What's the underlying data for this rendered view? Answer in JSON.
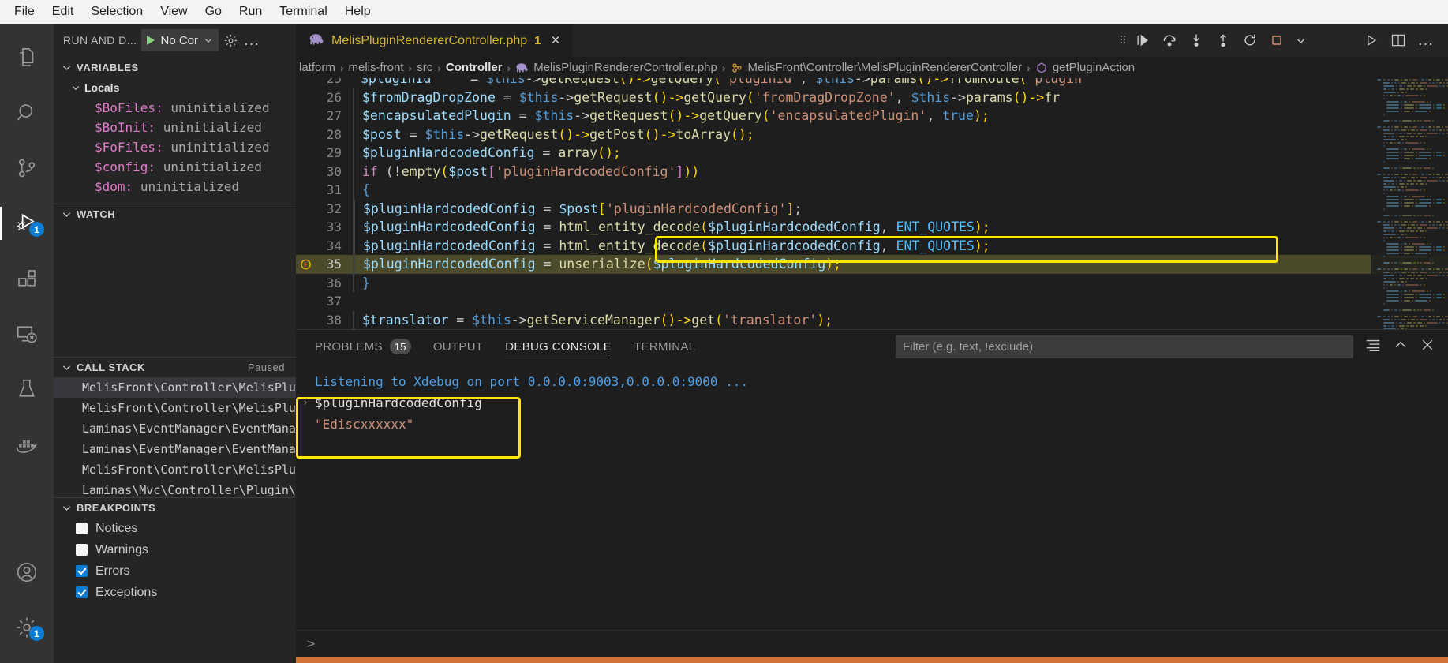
{
  "menubar": {
    "items": [
      "File",
      "Edit",
      "Selection",
      "View",
      "Go",
      "Run",
      "Terminal",
      "Help"
    ]
  },
  "activitybar": {
    "items": [
      {
        "name": "explorer-icon",
        "label": "Explorer",
        "active": false
      },
      {
        "name": "search-icon",
        "label": "Search",
        "active": false
      },
      {
        "name": "source-control-icon",
        "label": "Source Control",
        "active": false
      },
      {
        "name": "run-and-debug-icon",
        "label": "Run and Debug",
        "active": true,
        "badge": "1"
      },
      {
        "name": "extensions-icon",
        "label": "Extensions",
        "active": false
      },
      {
        "name": "remote-explorer-icon",
        "label": "Remote Explorer",
        "active": false
      },
      {
        "name": "testing-icon",
        "label": "Testing",
        "active": false
      },
      {
        "name": "docker-icon",
        "label": "Docker",
        "active": false
      }
    ],
    "bottom": [
      {
        "name": "accounts-icon",
        "label": "Accounts"
      },
      {
        "name": "settings-gear-icon",
        "label": "Manage",
        "badge": "1"
      }
    ]
  },
  "sidebar": {
    "title": "RUN AND D...",
    "config_label": "No Cor",
    "gear_title": "Open launch.json",
    "more_title": "Views and More Actions...",
    "variables": {
      "title": "VARIABLES",
      "scope": "Locals",
      "rows": [
        {
          "name": "$BoFiles:",
          "value": "uninitialized"
        },
        {
          "name": "$BoInit:",
          "value": "uninitialized"
        },
        {
          "name": "$FoFiles:",
          "value": "uninitialized"
        },
        {
          "name": "$config:",
          "value": "uninitialized"
        },
        {
          "name": "$dom:",
          "value": "uninitialized"
        }
      ]
    },
    "watch": {
      "title": "WATCH",
      "rows": []
    },
    "callstack": {
      "title": "CALL STACK",
      "status": "Paused",
      "rows": [
        "MelisFront\\Controller\\MelisPluginRe",
        "MelisFront\\Controller\\MelisPluginRe",
        "Laminas\\EventManager\\EventManager->",
        "Laminas\\EventManager\\EventManager->",
        "MelisFront\\Controller\\MelisPluginRe",
        "Laminas\\Mvc\\Controller\\Plugin\\Forw"
      ],
      "selected_index": 0
    },
    "breakpoints": {
      "title": "BREAKPOINTS",
      "rows": [
        {
          "label": "Notices",
          "checked": false
        },
        {
          "label": "Warnings",
          "checked": false
        },
        {
          "label": "Errors",
          "checked": true
        },
        {
          "label": "Exceptions",
          "checked": true
        }
      ]
    }
  },
  "editor": {
    "tab": {
      "filename": "MelisPluginRendererController.php",
      "problem_count": "1",
      "icon": "php-elephant-icon",
      "close_label": "×"
    },
    "tab_actions": [
      {
        "name": "run-python-icon",
        "label": "Run or Debug..."
      },
      {
        "name": "split-editor-icon",
        "label": "Split Editor Right"
      },
      {
        "name": "more-actions-icon",
        "label": "More Actions..."
      }
    ],
    "debug_toolbar": [
      {
        "name": "drag-grip-icon",
        "label": "Drag"
      },
      {
        "name": "continue-icon",
        "label": "Continue"
      },
      {
        "name": "step-over-icon",
        "label": "Step Over"
      },
      {
        "name": "step-into-icon",
        "label": "Step Into"
      },
      {
        "name": "step-out-icon",
        "label": "Step Out"
      },
      {
        "name": "restart-icon",
        "label": "Restart"
      },
      {
        "name": "stop-icon",
        "label": "Stop"
      },
      {
        "name": "chevron-down-icon",
        "label": "More"
      }
    ],
    "breadcrumbs": [
      {
        "text": "latform",
        "bold": false,
        "icon": null
      },
      {
        "text": "melis-front",
        "bold": false,
        "icon": null
      },
      {
        "text": "src",
        "bold": false,
        "icon": null
      },
      {
        "text": "Controller",
        "bold": true,
        "icon": null
      },
      {
        "text": "MelisPluginRendererController.php",
        "bold": false,
        "icon": "php-elephant-icon"
      },
      {
        "text": "MelisFront\\Controller\\MelisPluginRendererController",
        "bold": false,
        "icon": "class-icon"
      },
      {
        "text": "getPluginAction",
        "bold": false,
        "icon": "method-icon"
      }
    ],
    "lines": [
      {
        "num": "25",
        "clipped": true,
        "indent": 0,
        "tokens": [
          {
            "t": "$pluginId",
            "c": "t-var"
          },
          {
            "t": "     = ",
            "c": "t-punc"
          },
          {
            "t": "$this",
            "c": "t-ctl"
          },
          {
            "t": "->",
            "c": "t-punc"
          },
          {
            "t": "getRequest",
            "c": "t-fn"
          },
          {
            "t": "()->",
            "c": "t-brk"
          },
          {
            "t": "getQuery",
            "c": "t-fn"
          },
          {
            "t": "(",
            "c": "t-brk"
          },
          {
            "t": "'pluginId'",
            "c": "t-str"
          },
          {
            "t": ", ",
            "c": "t-punc"
          },
          {
            "t": "$this",
            "c": "t-ctl"
          },
          {
            "t": "->",
            "c": "t-punc"
          },
          {
            "t": "params",
            "c": "t-fn"
          },
          {
            "t": "()->",
            "c": "t-brk"
          },
          {
            "t": "fromRoute",
            "c": "t-fn"
          },
          {
            "t": "(",
            "c": "t-brk"
          },
          {
            "t": "'plugin",
            "c": "t-str"
          }
        ]
      },
      {
        "num": "26",
        "indent": 2,
        "tokens": [
          {
            "t": "$fromDragDropZone",
            "c": "t-var"
          },
          {
            "t": " = ",
            "c": "t-punc"
          },
          {
            "t": "$this",
            "c": "t-ctl"
          },
          {
            "t": "->",
            "c": "t-punc"
          },
          {
            "t": "getRequest",
            "c": "t-fn"
          },
          {
            "t": "()->",
            "c": "t-brk"
          },
          {
            "t": "getQuery",
            "c": "t-fn"
          },
          {
            "t": "(",
            "c": "t-brk"
          },
          {
            "t": "'fromDragDropZone'",
            "c": "t-str"
          },
          {
            "t": ", ",
            "c": "t-punc"
          },
          {
            "t": "$this",
            "c": "t-ctl"
          },
          {
            "t": "->",
            "c": "t-punc"
          },
          {
            "t": "params",
            "c": "t-fn"
          },
          {
            "t": "()->",
            "c": "t-brk"
          },
          {
            "t": "fr",
            "c": "t-fn"
          }
        ]
      },
      {
        "num": "27",
        "indent": 2,
        "tokens": [
          {
            "t": "$encapsulatedPlugin",
            "c": "t-var"
          },
          {
            "t": " = ",
            "c": "t-punc"
          },
          {
            "t": "$this",
            "c": "t-ctl"
          },
          {
            "t": "->",
            "c": "t-punc"
          },
          {
            "t": "getRequest",
            "c": "t-fn"
          },
          {
            "t": "()->",
            "c": "t-brk"
          },
          {
            "t": "getQuery",
            "c": "t-fn"
          },
          {
            "t": "(",
            "c": "t-brk"
          },
          {
            "t": "'encapsulatedPlugin'",
            "c": "t-str"
          },
          {
            "t": ", ",
            "c": "t-punc"
          },
          {
            "t": "true",
            "c": "t-ctl"
          },
          {
            "t": ");",
            "c": "t-brk"
          }
        ]
      },
      {
        "num": "28",
        "indent": 2,
        "tokens": [
          {
            "t": "$post",
            "c": "t-var"
          },
          {
            "t": " = ",
            "c": "t-punc"
          },
          {
            "t": "$this",
            "c": "t-ctl"
          },
          {
            "t": "->",
            "c": "t-punc"
          },
          {
            "t": "getRequest",
            "c": "t-fn"
          },
          {
            "t": "()->",
            "c": "t-brk"
          },
          {
            "t": "getPost",
            "c": "t-fn"
          },
          {
            "t": "()->",
            "c": "t-brk"
          },
          {
            "t": "toArray",
            "c": "t-fn"
          },
          {
            "t": "();",
            "c": "t-brk"
          }
        ]
      },
      {
        "num": "29",
        "indent": 2,
        "tokens": [
          {
            "t": "$pluginHardcodedConfig",
            "c": "t-var"
          },
          {
            "t": " = ",
            "c": "t-punc"
          },
          {
            "t": "array",
            "c": "t-fn"
          },
          {
            "t": "();",
            "c": "t-brk"
          }
        ]
      },
      {
        "num": "30",
        "indent": 2,
        "tokens": [
          {
            "t": "if",
            "c": "t-kw"
          },
          {
            "t": " (!",
            "c": "t-punc"
          },
          {
            "t": "empty",
            "c": "t-fn"
          },
          {
            "t": "(",
            "c": "t-brk"
          },
          {
            "t": "$post",
            "c": "t-var"
          },
          {
            "t": "[",
            "c": "t-brk2"
          },
          {
            "t": "'pluginHardcodedConfig'",
            "c": "t-str"
          },
          {
            "t": "]",
            "c": "t-brk2"
          },
          {
            "t": "))",
            "c": "t-brk"
          }
        ]
      },
      {
        "num": "31",
        "indent": 2,
        "tokens": [
          {
            "t": "{",
            "c": "t-brace"
          }
        ]
      },
      {
        "num": "32",
        "indent": 3,
        "tokens": [
          {
            "t": "$pluginHardcodedConfig",
            "c": "t-var"
          },
          {
            "t": " = ",
            "c": "t-punc"
          },
          {
            "t": "$post",
            "c": "t-var"
          },
          {
            "t": "[",
            "c": "t-brk"
          },
          {
            "t": "'pluginHardcodedConfig'",
            "c": "t-str"
          },
          {
            "t": "]",
            "c": "t-brk"
          },
          {
            "t": ";",
            "c": "t-punc"
          }
        ]
      },
      {
        "num": "33",
        "indent": 3,
        "tokens": [
          {
            "t": "$pluginHardcodedConfig",
            "c": "t-var"
          },
          {
            "t": " = ",
            "c": "t-punc"
          },
          {
            "t": "html_entity_decode",
            "c": "t-fn"
          },
          {
            "t": "(",
            "c": "t-brk"
          },
          {
            "t": "$pluginHardcodedConfig",
            "c": "t-var"
          },
          {
            "t": ", ",
            "c": "t-punc"
          },
          {
            "t": "ENT_QUOTES",
            "c": "t-const"
          },
          {
            "t": ");",
            "c": "t-brk"
          }
        ]
      },
      {
        "num": "34",
        "indent": 3,
        "tokens": [
          {
            "t": "$pluginHardcodedConfig",
            "c": "t-var"
          },
          {
            "t": " = ",
            "c": "t-punc"
          },
          {
            "t": "html_entity_decode",
            "c": "t-fn"
          },
          {
            "t": "(",
            "c": "t-brk"
          },
          {
            "t": "$pluginHardcodedConfig",
            "c": "t-var"
          },
          {
            "t": ", ",
            "c": "t-punc"
          },
          {
            "t": "ENT_QUOTES",
            "c": "t-const"
          },
          {
            "t": ");",
            "c": "t-brk"
          }
        ]
      },
      {
        "num": "35",
        "indent": 3,
        "highlighted": true,
        "breakpoint": true,
        "tokens": [
          {
            "t": "$pluginHardcodedConfig",
            "c": "t-var"
          },
          {
            "t": " = ",
            "c": "t-punc"
          },
          {
            "t": "unserialize",
            "c": "t-fn"
          },
          {
            "t": "(",
            "c": "t-brk"
          },
          {
            "t": "$pluginHardcodedConfig",
            "c": "t-var"
          },
          {
            "t": ");",
            "c": "t-brk"
          }
        ]
      },
      {
        "num": "36",
        "indent": 2,
        "tokens": [
          {
            "t": "}",
            "c": "t-brace"
          }
        ]
      },
      {
        "num": "37",
        "indent": 0,
        "tokens": []
      },
      {
        "num": "38",
        "indent": 2,
        "tokens": [
          {
            "t": "$translator",
            "c": "t-var"
          },
          {
            "t": " = ",
            "c": "t-punc"
          },
          {
            "t": "$this",
            "c": "t-ctl"
          },
          {
            "t": "->",
            "c": "t-punc"
          },
          {
            "t": "getServiceManager",
            "c": "t-fn"
          },
          {
            "t": "()->",
            "c": "t-brk"
          },
          {
            "t": "get",
            "c": "t-fn"
          },
          {
            "t": "(",
            "c": "t-brk"
          },
          {
            "t": "'translator'",
            "c": "t-str"
          },
          {
            "t": ");",
            "c": "t-brk"
          }
        ]
      },
      {
        "num": "39",
        "clipped": true,
        "indent": 0,
        "tokens": []
      }
    ],
    "annotation_code": "highlight-box-line-35"
  },
  "panel": {
    "tabs": [
      {
        "label": "PROBLEMS",
        "badge": "15",
        "active": false
      },
      {
        "label": "OUTPUT",
        "badge": null,
        "active": false
      },
      {
        "label": "DEBUG CONSOLE",
        "badge": null,
        "active": true
      },
      {
        "label": "TERMINAL",
        "badge": null,
        "active": false
      }
    ],
    "filter_placeholder": "Filter (e.g. text, !exclude)",
    "filter_value": "",
    "actions": [
      {
        "name": "clear-console-icon",
        "label": "Clear Console"
      },
      {
        "name": "chevron-up-icon",
        "label": "Maximize Panel Size"
      },
      {
        "name": "close-panel-icon",
        "label": "Close Panel"
      }
    ],
    "console": {
      "lines": [
        {
          "text": "Listening to Xdebug on port 0.0.0.0:9003,0.0.0.0:9000 ...",
          "style": "blue",
          "arrow": false
        },
        {
          "text": "$pluginHardcodedConfig",
          "style": "white",
          "arrow": true
        },
        {
          "text": "\"Ediscxxxxxx\"",
          "style": "string",
          "arrow": false
        }
      ],
      "prompt": ">",
      "annotation": "highlight-box-console-output"
    }
  },
  "colors": {
    "accent_yellow": "#ffe600",
    "badge_blue": "#0a7cd4",
    "statusbar_orange": "#d4703a",
    "tab_gold": "#d7b92e"
  }
}
